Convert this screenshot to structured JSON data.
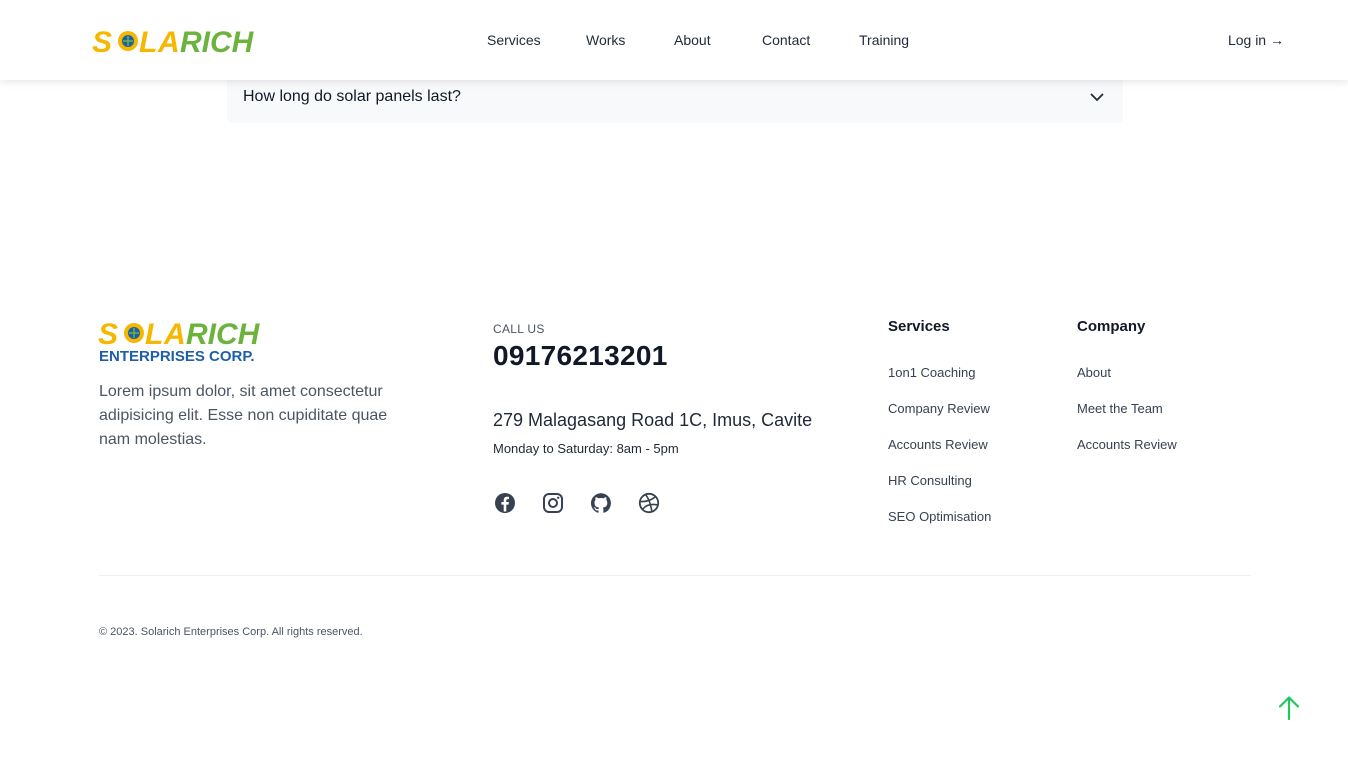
{
  "brand": {
    "logo_text": "SOLARICH",
    "logo_subtext": "ENTERPRISES CORP.",
    "colors": {
      "yellow": "#f5b700",
      "green": "#6cb33e",
      "blue": "#1f5fa8",
      "accent": "#22c55e"
    }
  },
  "nav": {
    "items": [
      {
        "label": "Services"
      },
      {
        "label": "Works"
      },
      {
        "label": "About"
      },
      {
        "label": "Contact"
      },
      {
        "label": "Training"
      }
    ],
    "login_label": "Log in →"
  },
  "faq": {
    "question": "How long do solar panels last?",
    "icon": "chevron-down-icon"
  },
  "footer": {
    "description": "Lorem ipsum dolor, sit amet consectetur adipisicing elit. Esse non cupiditate quae nam molestias.",
    "call_label": "CALL US",
    "phone": "09176213201",
    "address": "279 Malagasang Road 1C, Imus, Cavite",
    "hours": "Monday to Saturday: 8am - 5pm",
    "socials": [
      {
        "icon": "facebook-icon"
      },
      {
        "icon": "instagram-icon"
      },
      {
        "icon": "github-icon"
      },
      {
        "icon": "dribbble-icon"
      }
    ],
    "services": {
      "title": "Services",
      "links": [
        "1on1 Coaching",
        "Company Review",
        "Accounts Review",
        "HR Consulting",
        "SEO Optimisation"
      ]
    },
    "company": {
      "title": "Company",
      "links": [
        "About",
        "Meet the Team",
        "Accounts Review"
      ]
    },
    "copyright": "© 2023. Solarich Enterprises Corp. All rights reserved."
  },
  "scroll_top_icon": "arrow-up-icon"
}
